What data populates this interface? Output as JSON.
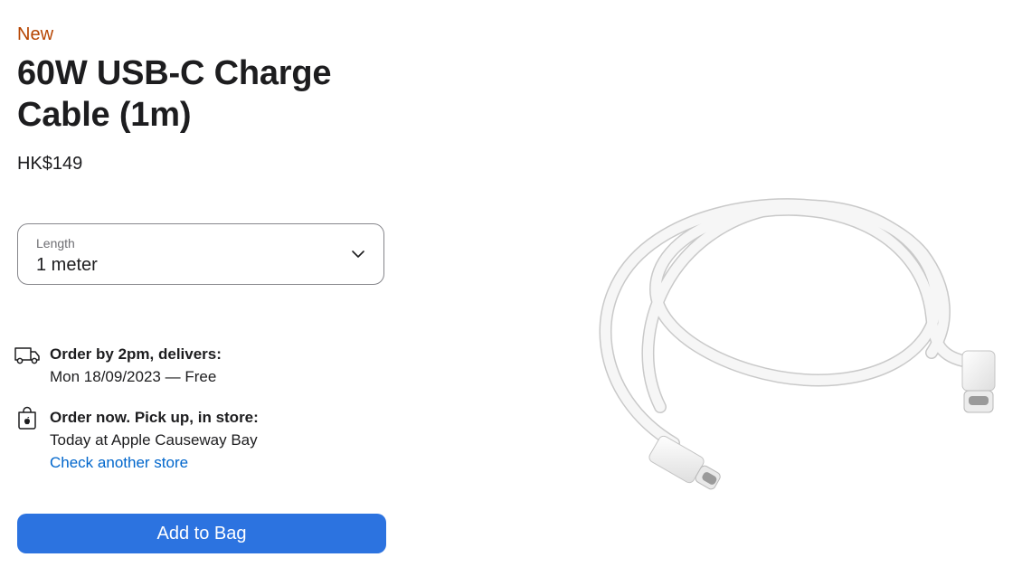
{
  "product": {
    "badge": "New",
    "title": "60W USB-C Charge Cable (1m)",
    "price": "HK$149"
  },
  "length_selector": {
    "label": "Length",
    "selected": "1 meter",
    "icon": "chevron-down-icon"
  },
  "delivery": {
    "icon": "truck-icon",
    "heading": "Order by 2pm, delivers:",
    "detail": "Mon 18/09/2023 — Free"
  },
  "pickup": {
    "icon": "shopping-bag-icon",
    "heading": "Order now. Pick up, in store:",
    "detail": "Today at Apple Causeway Bay",
    "link": "Check another store"
  },
  "actions": {
    "add_to_bag": "Add to Bag"
  },
  "colors": {
    "badge": "#b64400",
    "link": "#0066cc",
    "button": "#2c73e0",
    "text": "#1d1d1f"
  }
}
